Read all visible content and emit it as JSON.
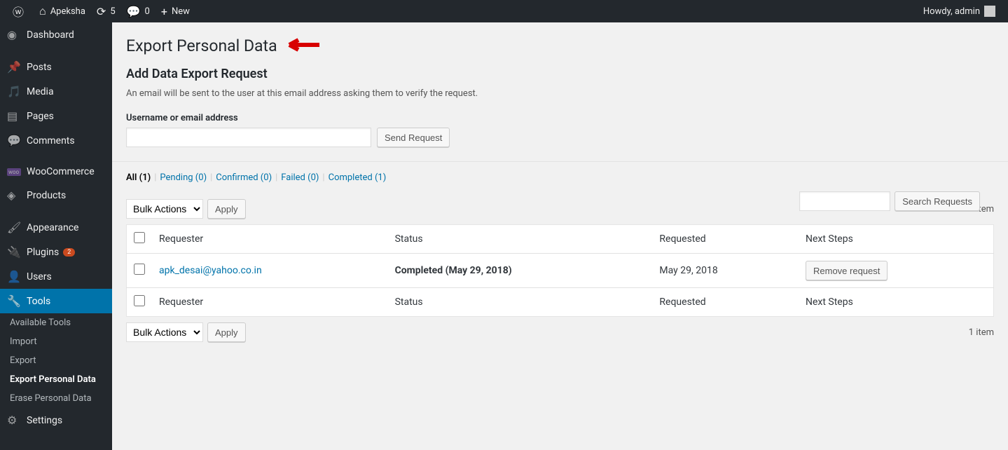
{
  "adminbar": {
    "site_name": "Apeksha",
    "updates_count": "5",
    "comments_count": "0",
    "new_label": "New",
    "howdy": "Howdy, admin"
  },
  "sidebar": {
    "items": [
      {
        "icon": "⌂",
        "label": "Dashboard"
      },
      {
        "icon": "✎",
        "label": "Posts"
      },
      {
        "icon": "✿",
        "label": "Media"
      },
      {
        "icon": "▤",
        "label": "Pages"
      },
      {
        "icon": "✉",
        "label": "Comments"
      },
      {
        "icon": "⬚",
        "label": "WooCommerce"
      },
      {
        "icon": "◈",
        "label": "Products"
      },
      {
        "icon": "✦",
        "label": "Appearance"
      },
      {
        "icon": "⚡",
        "label": "Plugins",
        "badge": "2"
      },
      {
        "icon": "👤",
        "label": "Users"
      },
      {
        "icon": "🔧",
        "label": "Tools"
      },
      {
        "icon": "⚙",
        "label": "Settings"
      }
    ],
    "submenu": [
      "Available Tools",
      "Import",
      "Export",
      "Export Personal Data",
      "Erase Personal Data"
    ]
  },
  "page": {
    "title": "Export Personal Data",
    "subtitle": "Add Data Export Request",
    "description": "An email will be sent to the user at this email address asking them to verify the request.",
    "field_label": "Username or email address",
    "send_request": "Send Request",
    "search_button": "Search Requests"
  },
  "filters": [
    {
      "label": "All",
      "count": "1",
      "current": true
    },
    {
      "label": "Pending",
      "count": "0"
    },
    {
      "label": "Confirmed",
      "count": "0"
    },
    {
      "label": "Failed",
      "count": "0"
    },
    {
      "label": "Completed",
      "count": "1"
    }
  ],
  "bulk": {
    "select_label": "Bulk Actions",
    "apply": "Apply"
  },
  "pagination": {
    "item_count": "1 item"
  },
  "table": {
    "headers": [
      "Requester",
      "Status",
      "Requested",
      "Next Steps"
    ],
    "rows": [
      {
        "requester": "apk_desai@yahoo.co.in",
        "status": "Completed (May 29, 2018)",
        "requested": "May 29, 2018",
        "next_action": "Remove request"
      }
    ]
  }
}
